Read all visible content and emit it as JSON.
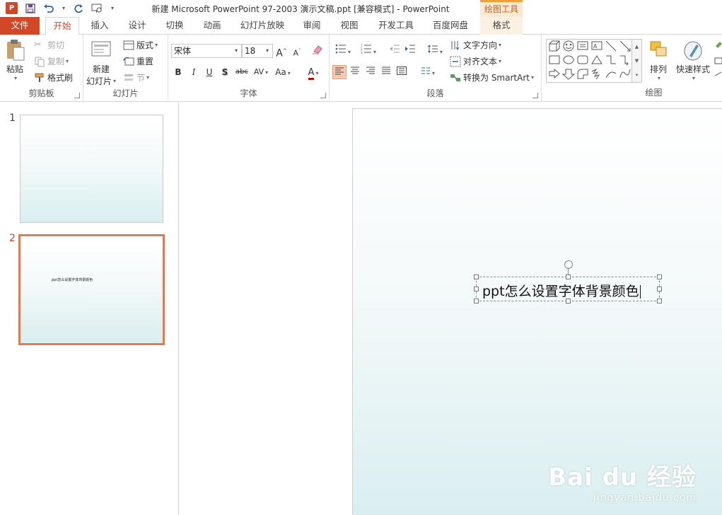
{
  "window": {
    "title": "新建 Microsoft PowerPoint 97-2003 演示文稿.ppt [兼容模式] - PowerPoint",
    "context_tab_group": "绘图工具",
    "accent_color": "#d24726"
  },
  "quick_access": {
    "app_icon": "P",
    "icons": [
      "save-icon",
      "undo-icon",
      "redo-icon",
      "slideshow-icon",
      "customize-icon"
    ]
  },
  "tabs": [
    "文件",
    "开始",
    "插入",
    "设计",
    "切换",
    "动画",
    "幻灯片放映",
    "审阅",
    "视图",
    "开发工具",
    "百度网盘",
    "格式"
  ],
  "active_tab": "开始",
  "ribbon": {
    "clipboard": {
      "label": "剪贴板",
      "paste": "粘贴",
      "cut": "剪切",
      "copy": "复制",
      "format_painter": "格式刷"
    },
    "slides": {
      "label": "幻灯片",
      "new_slide_line1": "新建",
      "new_slide_line2": "幻灯片",
      "layout": "版式",
      "reset": "重置",
      "section": "节"
    },
    "font": {
      "label": "字体",
      "font_name": "宋体",
      "font_size": "18",
      "bold": "B",
      "italic": "I",
      "underline": "U",
      "shadow": "S",
      "strike": "abc",
      "spacing": "AV",
      "change_case": "Aa",
      "font_color_letter": "A",
      "grow": "A",
      "shrink": "A"
    },
    "paragraph": {
      "label": "段落",
      "text_direction": "文字方向",
      "align_text": "对齐文本",
      "smartart": "转换为 SmartArt"
    },
    "drawing": {
      "label": "绘图",
      "arrange": "排列",
      "quick_styles": "快速样式"
    }
  },
  "slides": [
    {
      "number": "1",
      "text": ""
    },
    {
      "number": "2",
      "text": "ppt怎么设置字体背景颜色"
    }
  ],
  "selected_slide": "2",
  "editor": {
    "textbox_text": "ppt怎么设置字体背景颜色"
  },
  "watermark": {
    "logo": "Bai du 经验",
    "url": "jingyan.baidu.com"
  }
}
